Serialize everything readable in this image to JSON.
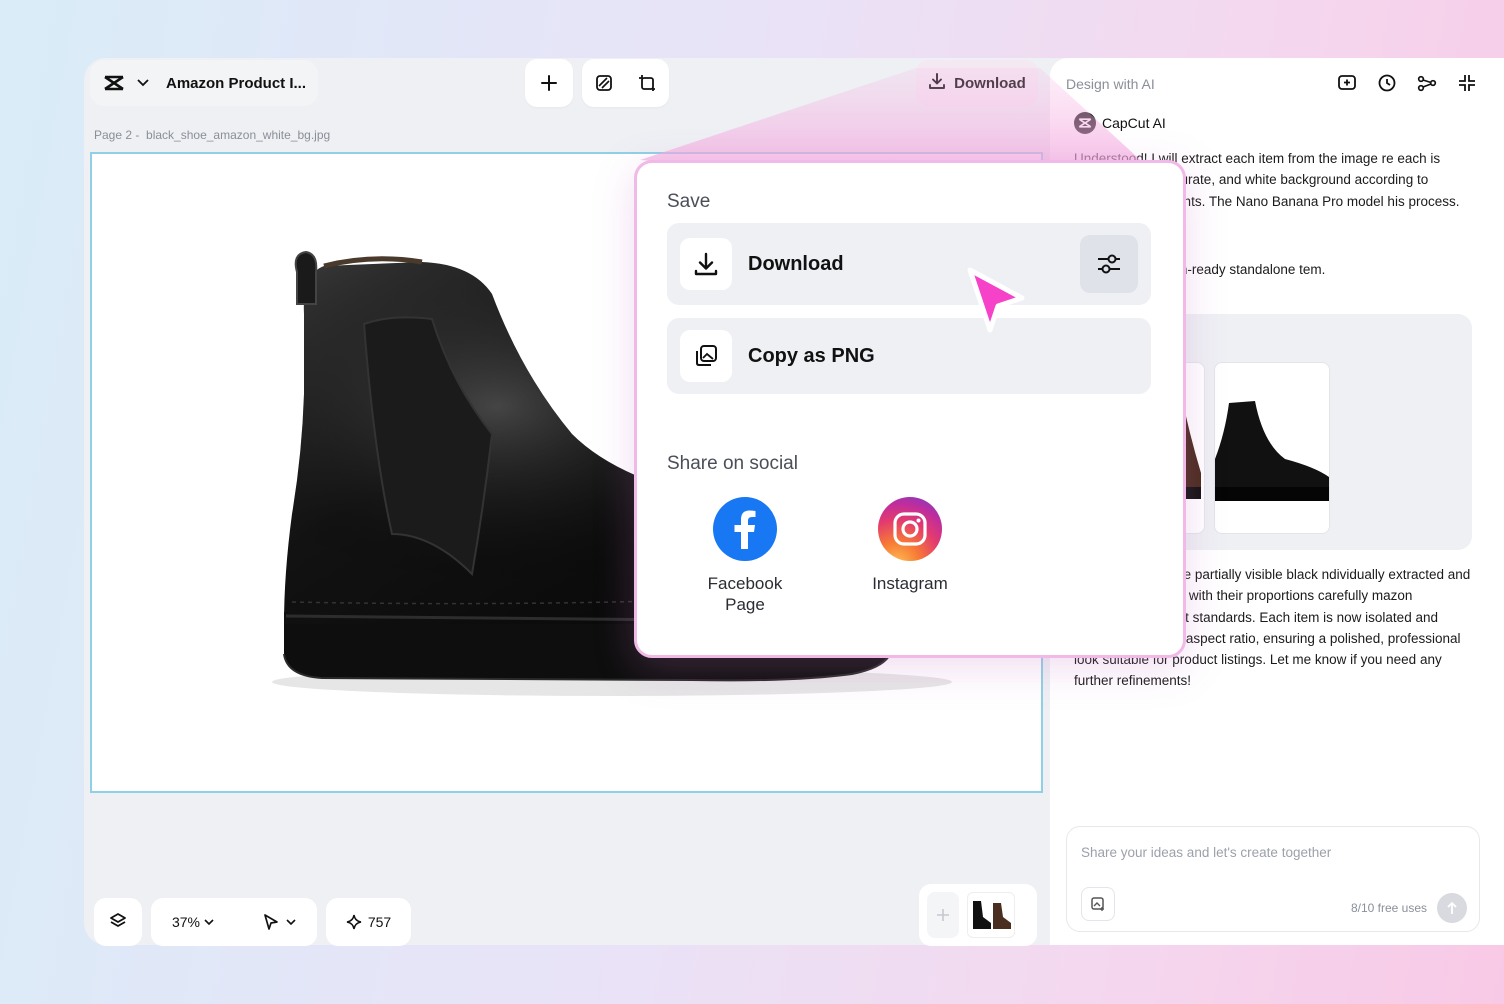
{
  "header": {
    "project_name": "Amazon Product I...",
    "download_label": "Download"
  },
  "canvas": {
    "page_number": "Page 2 -",
    "file_name": "black_shoe_amazon_white_bg.jpg"
  },
  "bottom_toolbar": {
    "zoom": "37%",
    "credits": "757"
  },
  "panel": {
    "title": "Design with AI",
    "assistant_name": "CapCut AI",
    "message_1": "Understood! I will extract each item from the image re each is dimensionally accurate, and white background according to Amazon equirements. The Nano Banana Pro model his process.",
    "message_2": "nerate the Amazon-ready standalone tem.",
    "message_3": "eather boot and the partially visible black ndividually extracted and placed on pure ds, with their proportions carefully mazon standalone product standards. Each item is now isolated and presented in a 3:2 aspect ratio, ensuring a polished, professional look suitable for product listings. Let me know if you need any further refinements!",
    "input_placeholder": "Share your ideas and let's create together",
    "free_uses": "8/10 free uses"
  },
  "popup": {
    "save_heading": "Save",
    "download_label": "Download",
    "copy_label": "Copy as PNG",
    "share_heading": "Share on social",
    "facebook_label": "Facebook Page",
    "instagram_label": "Instagram"
  },
  "colors": {
    "accent_pink": "#f542c8",
    "facebook_blue": "#1877f2",
    "canvas_border": "#8fd0e6"
  }
}
